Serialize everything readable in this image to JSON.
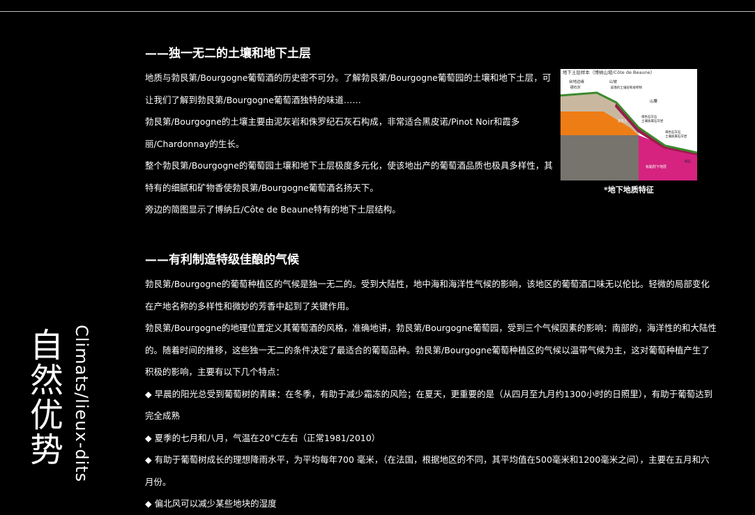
{
  "side_title": {
    "chinese": "自然优势",
    "english": "Climats/lieux-dits"
  },
  "section1": {
    "heading": "——独一无二的土壤和地下土层",
    "paragraphs": [
      "地质与勃艮第/Bourgogne葡萄酒的历史密不可分。了解勃艮第/Bourgogne葡萄园的土壤和地下土层，可让我们了解到勃艮第/Bourgogne葡萄酒独特的味道……",
      "勃艮第/Bourgogne的土壤主要由泥灰岩和侏罗纪石灰石构成，非常适合黑皮诺/Pinot Noir和霞多丽/Chardonnay的生长。",
      "整个勃艮第/Bourgogne的葡萄园土壤和地下土层极度多元化，使该地出产的葡萄酒品质也极具多样性，其特有的细腻和矿物香使勃艮第/Bourgogne葡萄酒名扬天下。",
      "旁边的简图显示了博纳丘/Côte de Beaune特有的地下土层结构。"
    ]
  },
  "figure": {
    "title": "地下土层样本（博纳山坡/Côte de Beaune）",
    "labels": {
      "plateau": "台地边缘",
      "plateau_sub": "硬石灰",
      "slope": "山坡",
      "slope_note": "崩落的土壤层和坡积物",
      "mountain": "山腰",
      "marl": "泥灰土",
      "brown": "褐色石灰石",
      "brown_sub": "土壤质属石灰岩",
      "red": "褐色石灰石",
      "red_sub": "土壤质属石灰岩",
      "pink": "有黏附下地层",
      "bottom": "碎石"
    },
    "caption": "*地下地质特征",
    "colors": {
      "topsoil": "#c9b89f",
      "orange": "#ef7d16",
      "gray": "#77736d",
      "magenta": "#d5237f",
      "vine": "#3c8a2e"
    }
  },
  "section2": {
    "heading": "——有利制造特级佳酿的气候",
    "paragraphs": [
      "勃艮第/Bourgogne的葡萄种植区的气候是独一无二的。受到大陆性，地中海和海洋性气候的影响，该地区的葡萄酒口味无以伦比。轻微的局部变化在产地名称的多样性和微妙的芳香中起到了关键作用。",
      "勃艮第/Bourgogne的地理位置定义其葡萄酒的风格，准确地讲，勃艮第/Bourgogne葡萄园，受到三个气候因素的影响：南部的，海洋性的和大陆性的。随着时间的推移，这些独一无二的条件决定了最适合的葡萄品种。勃艮第/Bourgogne葡萄种植区的气候以温带气候为主，这对葡萄种植产生了积极的影响，主要有以下几个特点："
    ],
    "bullets": [
      "◆ 早晨的阳光总受到葡萄树的青睐：在冬季，有助于减少霜冻的风险；在夏天，更重要的是（从四月至九月约1300小时的日照里），有助于葡萄达到完全成熟",
      "◆ 夏季的七月和八月，气温在20°C左右（正常1981/2010）",
      "◆ 有助于葡萄树成长的理想降雨水平，为平均每年700 毫米，（在法国，根据地区的不同，其平均值在500毫米和1200毫米之间），主要在五月和六月份。",
      "◆ 偏北风可以减少某些地块的湿度"
    ]
  }
}
